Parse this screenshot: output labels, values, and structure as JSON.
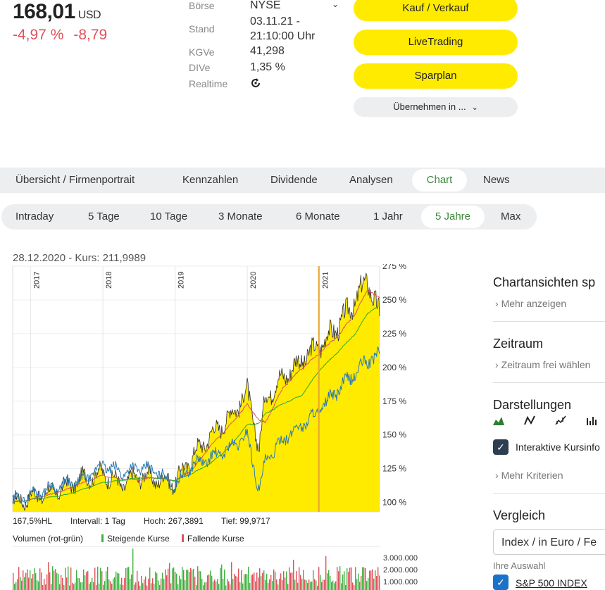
{
  "quote": {
    "price": "168,01",
    "currency": "USD",
    "change_pct": "-4,97 %",
    "change_abs": "-8,79"
  },
  "info": {
    "boerse_label": "Börse",
    "boerse_value": "NYSE",
    "stand_label": "Stand",
    "stand_date": "03.11.21 -",
    "stand_time": "21:10:00 Uhr",
    "kgve_label": "KGVe",
    "kgve_value": "41,298",
    "dive_label": "DIVe",
    "dive_value": "1,35 %",
    "realtime_label": "Realtime"
  },
  "actions": {
    "buy_sell": "Kauf / Verkauf",
    "live": "LiveTrading",
    "savings": "Sparplan",
    "adopt": "Übernehmen in ..."
  },
  "tabs": [
    "Übersicht / Firmenportrait",
    "Kennzahlen",
    "Dividende",
    "Analysen",
    "Chart",
    "News"
  ],
  "timeframes": [
    "Intraday",
    "5 Tage",
    "10 Tage",
    "3 Monate",
    "6 Monate",
    "1 Jahr",
    "5 Jahre",
    "Max"
  ],
  "chart_header": "28.12.2020  -  Kurs: 211,9989",
  "chart_stats": {
    "hl": "167,5%HL",
    "interval": "Intervall: 1 Tag",
    "high": "Hoch: 267,3891",
    "low": "Tief: 99,9717"
  },
  "volume": {
    "label": "Volumen (rot-grün)",
    "rising": "Steigende Kurse",
    "falling": "Fallende Kurse",
    "ticks": [
      "3.000.000",
      "2.000.000",
      "1.000.000"
    ]
  },
  "sidebar": {
    "views_title": "Chartansichten sp",
    "more": "Mehr anzeigen",
    "period_title": "Zeitraum",
    "period_free": "Zeitraum frei wählen",
    "display_title": "Darstellungen",
    "interactive": "Interaktive Kursinfo",
    "more_criteria": "Mehr Kriterien",
    "compare_title": "Vergleich",
    "compare_select": "Index / in Euro / Fe",
    "selection_label": "Ihre Auswahl",
    "sp500": "S&P 500 INDEX"
  },
  "colors": {
    "accent_yellow": "#ffeb00",
    "negative": "#e0515b",
    "positive_green": "#3a8a3a",
    "index_line": "#2a7ab8"
  },
  "chart_data": {
    "type": "area",
    "x": [
      "2016-10",
      "2017-01",
      "2017-04",
      "2017-07",
      "2017-10",
      "2018-01",
      "2018-04",
      "2018-07",
      "2018-10",
      "2019-01",
      "2019-04",
      "2019-07",
      "2019-10",
      "2020-01",
      "2020-03",
      "2020-04",
      "2020-07",
      "2020-10",
      "2021-01",
      "2021-04",
      "2021-07",
      "2021-09",
      "2021-11"
    ],
    "series": [
      {
        "values": [
          100,
          104,
          107,
          112,
          118,
          122,
          113,
          120,
          117,
          115,
          135,
          150,
          163,
          182,
          140,
          178,
          193,
          205,
          216,
          230,
          250,
          265,
          238
        ]
      },
      {
        "name": "S&P 500 INDEX",
        "values": [
          100,
          106,
          110,
          113,
          117,
          128,
          122,
          126,
          123,
          112,
          128,
          133,
          140,
          150,
          108,
          130,
          147,
          157,
          168,
          183,
          196,
          205,
          210
        ]
      }
    ],
    "year_labels": [
      "2017",
      "2018",
      "2019",
      "2020",
      "2021"
    ],
    "y_ticks": [
      "275 %",
      "250 %",
      "225 %",
      "200 %",
      "175 %",
      "150 %",
      "125 %",
      "100 %"
    ],
    "ylim": [
      93,
      275
    ]
  }
}
